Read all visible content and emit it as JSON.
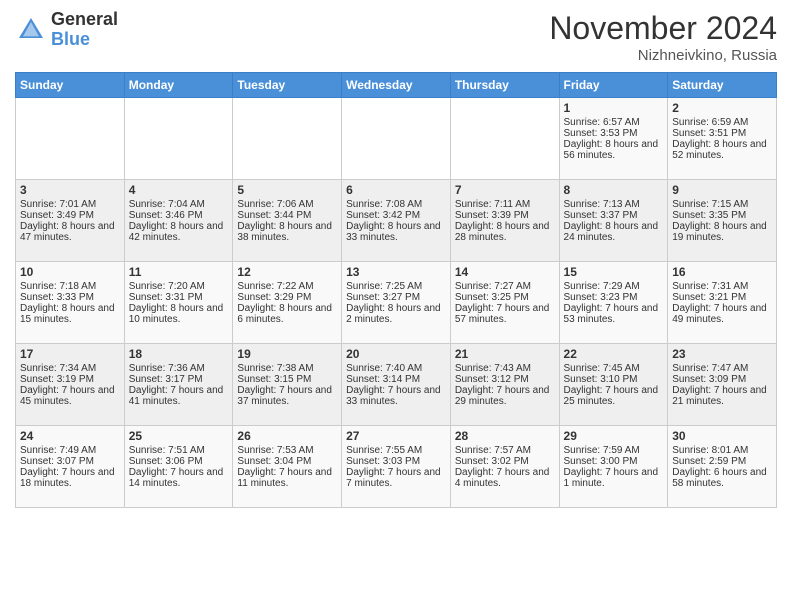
{
  "logo": {
    "general": "General",
    "blue": "Blue"
  },
  "title": "November 2024",
  "location": "Nizhneivkino, Russia",
  "days_header": [
    "Sunday",
    "Monday",
    "Tuesday",
    "Wednesday",
    "Thursday",
    "Friday",
    "Saturday"
  ],
  "weeks": [
    [
      {
        "num": "",
        "sunrise": "",
        "sunset": "",
        "daylight": ""
      },
      {
        "num": "",
        "sunrise": "",
        "sunset": "",
        "daylight": ""
      },
      {
        "num": "",
        "sunrise": "",
        "sunset": "",
        "daylight": ""
      },
      {
        "num": "",
        "sunrise": "",
        "sunset": "",
        "daylight": ""
      },
      {
        "num": "",
        "sunrise": "",
        "sunset": "",
        "daylight": ""
      },
      {
        "num": "1",
        "sunrise": "Sunrise: 6:57 AM",
        "sunset": "Sunset: 3:53 PM",
        "daylight": "Daylight: 8 hours and 56 minutes."
      },
      {
        "num": "2",
        "sunrise": "Sunrise: 6:59 AM",
        "sunset": "Sunset: 3:51 PM",
        "daylight": "Daylight: 8 hours and 52 minutes."
      }
    ],
    [
      {
        "num": "3",
        "sunrise": "Sunrise: 7:01 AM",
        "sunset": "Sunset: 3:49 PM",
        "daylight": "Daylight: 8 hours and 47 minutes."
      },
      {
        "num": "4",
        "sunrise": "Sunrise: 7:04 AM",
        "sunset": "Sunset: 3:46 PM",
        "daylight": "Daylight: 8 hours and 42 minutes."
      },
      {
        "num": "5",
        "sunrise": "Sunrise: 7:06 AM",
        "sunset": "Sunset: 3:44 PM",
        "daylight": "Daylight: 8 hours and 38 minutes."
      },
      {
        "num": "6",
        "sunrise": "Sunrise: 7:08 AM",
        "sunset": "Sunset: 3:42 PM",
        "daylight": "Daylight: 8 hours and 33 minutes."
      },
      {
        "num": "7",
        "sunrise": "Sunrise: 7:11 AM",
        "sunset": "Sunset: 3:39 PM",
        "daylight": "Daylight: 8 hours and 28 minutes."
      },
      {
        "num": "8",
        "sunrise": "Sunrise: 7:13 AM",
        "sunset": "Sunset: 3:37 PM",
        "daylight": "Daylight: 8 hours and 24 minutes."
      },
      {
        "num": "9",
        "sunrise": "Sunrise: 7:15 AM",
        "sunset": "Sunset: 3:35 PM",
        "daylight": "Daylight: 8 hours and 19 minutes."
      }
    ],
    [
      {
        "num": "10",
        "sunrise": "Sunrise: 7:18 AM",
        "sunset": "Sunset: 3:33 PM",
        "daylight": "Daylight: 8 hours and 15 minutes."
      },
      {
        "num": "11",
        "sunrise": "Sunrise: 7:20 AM",
        "sunset": "Sunset: 3:31 PM",
        "daylight": "Daylight: 8 hours and 10 minutes."
      },
      {
        "num": "12",
        "sunrise": "Sunrise: 7:22 AM",
        "sunset": "Sunset: 3:29 PM",
        "daylight": "Daylight: 8 hours and 6 minutes."
      },
      {
        "num": "13",
        "sunrise": "Sunrise: 7:25 AM",
        "sunset": "Sunset: 3:27 PM",
        "daylight": "Daylight: 8 hours and 2 minutes."
      },
      {
        "num": "14",
        "sunrise": "Sunrise: 7:27 AM",
        "sunset": "Sunset: 3:25 PM",
        "daylight": "Daylight: 7 hours and 57 minutes."
      },
      {
        "num": "15",
        "sunrise": "Sunrise: 7:29 AM",
        "sunset": "Sunset: 3:23 PM",
        "daylight": "Daylight: 7 hours and 53 minutes."
      },
      {
        "num": "16",
        "sunrise": "Sunrise: 7:31 AM",
        "sunset": "Sunset: 3:21 PM",
        "daylight": "Daylight: 7 hours and 49 minutes."
      }
    ],
    [
      {
        "num": "17",
        "sunrise": "Sunrise: 7:34 AM",
        "sunset": "Sunset: 3:19 PM",
        "daylight": "Daylight: 7 hours and 45 minutes."
      },
      {
        "num": "18",
        "sunrise": "Sunrise: 7:36 AM",
        "sunset": "Sunset: 3:17 PM",
        "daylight": "Daylight: 7 hours and 41 minutes."
      },
      {
        "num": "19",
        "sunrise": "Sunrise: 7:38 AM",
        "sunset": "Sunset: 3:15 PM",
        "daylight": "Daylight: 7 hours and 37 minutes."
      },
      {
        "num": "20",
        "sunrise": "Sunrise: 7:40 AM",
        "sunset": "Sunset: 3:14 PM",
        "daylight": "Daylight: 7 hours and 33 minutes."
      },
      {
        "num": "21",
        "sunrise": "Sunrise: 7:43 AM",
        "sunset": "Sunset: 3:12 PM",
        "daylight": "Daylight: 7 hours and 29 minutes."
      },
      {
        "num": "22",
        "sunrise": "Sunrise: 7:45 AM",
        "sunset": "Sunset: 3:10 PM",
        "daylight": "Daylight: 7 hours and 25 minutes."
      },
      {
        "num": "23",
        "sunrise": "Sunrise: 7:47 AM",
        "sunset": "Sunset: 3:09 PM",
        "daylight": "Daylight: 7 hours and 21 minutes."
      }
    ],
    [
      {
        "num": "24",
        "sunrise": "Sunrise: 7:49 AM",
        "sunset": "Sunset: 3:07 PM",
        "daylight": "Daylight: 7 hours and 18 minutes."
      },
      {
        "num": "25",
        "sunrise": "Sunrise: 7:51 AM",
        "sunset": "Sunset: 3:06 PM",
        "daylight": "Daylight: 7 hours and 14 minutes."
      },
      {
        "num": "26",
        "sunrise": "Sunrise: 7:53 AM",
        "sunset": "Sunset: 3:04 PM",
        "daylight": "Daylight: 7 hours and 11 minutes."
      },
      {
        "num": "27",
        "sunrise": "Sunrise: 7:55 AM",
        "sunset": "Sunset: 3:03 PM",
        "daylight": "Daylight: 7 hours and 7 minutes."
      },
      {
        "num": "28",
        "sunrise": "Sunrise: 7:57 AM",
        "sunset": "Sunset: 3:02 PM",
        "daylight": "Daylight: 7 hours and 4 minutes."
      },
      {
        "num": "29",
        "sunrise": "Sunrise: 7:59 AM",
        "sunset": "Sunset: 3:00 PM",
        "daylight": "Daylight: 7 hours and 1 minute."
      },
      {
        "num": "30",
        "sunrise": "Sunrise: 8:01 AM",
        "sunset": "Sunset: 2:59 PM",
        "daylight": "Daylight: 6 hours and 58 minutes."
      }
    ]
  ]
}
